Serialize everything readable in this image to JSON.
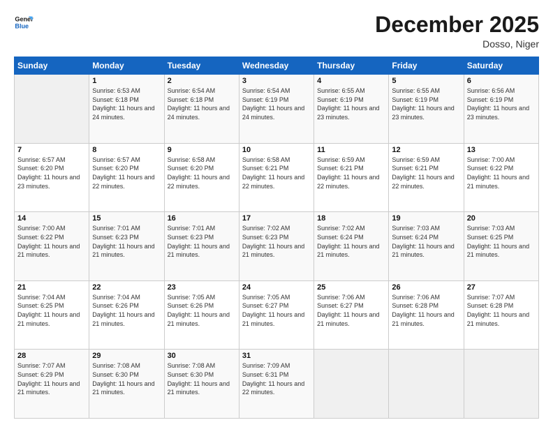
{
  "header": {
    "logo_line1": "General",
    "logo_line2": "Blue",
    "month": "December 2025",
    "location": "Dosso, Niger"
  },
  "weekdays": [
    "Sunday",
    "Monday",
    "Tuesday",
    "Wednesday",
    "Thursday",
    "Friday",
    "Saturday"
  ],
  "weeks": [
    [
      {
        "day": "",
        "sunrise": "",
        "sunset": "",
        "daylight": ""
      },
      {
        "day": "1",
        "sunrise": "6:53 AM",
        "sunset": "6:18 PM",
        "daylight": "11 hours and 24 minutes."
      },
      {
        "day": "2",
        "sunrise": "6:54 AM",
        "sunset": "6:18 PM",
        "daylight": "11 hours and 24 minutes."
      },
      {
        "day": "3",
        "sunrise": "6:54 AM",
        "sunset": "6:19 PM",
        "daylight": "11 hours and 24 minutes."
      },
      {
        "day": "4",
        "sunrise": "6:55 AM",
        "sunset": "6:19 PM",
        "daylight": "11 hours and 23 minutes."
      },
      {
        "day": "5",
        "sunrise": "6:55 AM",
        "sunset": "6:19 PM",
        "daylight": "11 hours and 23 minutes."
      },
      {
        "day": "6",
        "sunrise": "6:56 AM",
        "sunset": "6:19 PM",
        "daylight": "11 hours and 23 minutes."
      }
    ],
    [
      {
        "day": "7",
        "sunrise": "6:57 AM",
        "sunset": "6:20 PM",
        "daylight": "11 hours and 23 minutes."
      },
      {
        "day": "8",
        "sunrise": "6:57 AM",
        "sunset": "6:20 PM",
        "daylight": "11 hours and 22 minutes."
      },
      {
        "day": "9",
        "sunrise": "6:58 AM",
        "sunset": "6:20 PM",
        "daylight": "11 hours and 22 minutes."
      },
      {
        "day": "10",
        "sunrise": "6:58 AM",
        "sunset": "6:21 PM",
        "daylight": "11 hours and 22 minutes."
      },
      {
        "day": "11",
        "sunrise": "6:59 AM",
        "sunset": "6:21 PM",
        "daylight": "11 hours and 22 minutes."
      },
      {
        "day": "12",
        "sunrise": "6:59 AM",
        "sunset": "6:21 PM",
        "daylight": "11 hours and 22 minutes."
      },
      {
        "day": "13",
        "sunrise": "7:00 AM",
        "sunset": "6:22 PM",
        "daylight": "11 hours and 21 minutes."
      }
    ],
    [
      {
        "day": "14",
        "sunrise": "7:00 AM",
        "sunset": "6:22 PM",
        "daylight": "11 hours and 21 minutes."
      },
      {
        "day": "15",
        "sunrise": "7:01 AM",
        "sunset": "6:23 PM",
        "daylight": "11 hours and 21 minutes."
      },
      {
        "day": "16",
        "sunrise": "7:01 AM",
        "sunset": "6:23 PM",
        "daylight": "11 hours and 21 minutes."
      },
      {
        "day": "17",
        "sunrise": "7:02 AM",
        "sunset": "6:23 PM",
        "daylight": "11 hours and 21 minutes."
      },
      {
        "day": "18",
        "sunrise": "7:02 AM",
        "sunset": "6:24 PM",
        "daylight": "11 hours and 21 minutes."
      },
      {
        "day": "19",
        "sunrise": "7:03 AM",
        "sunset": "6:24 PM",
        "daylight": "11 hours and 21 minutes."
      },
      {
        "day": "20",
        "sunrise": "7:03 AM",
        "sunset": "6:25 PM",
        "daylight": "11 hours and 21 minutes."
      }
    ],
    [
      {
        "day": "21",
        "sunrise": "7:04 AM",
        "sunset": "6:25 PM",
        "daylight": "11 hours and 21 minutes."
      },
      {
        "day": "22",
        "sunrise": "7:04 AM",
        "sunset": "6:26 PM",
        "daylight": "11 hours and 21 minutes."
      },
      {
        "day": "23",
        "sunrise": "7:05 AM",
        "sunset": "6:26 PM",
        "daylight": "11 hours and 21 minutes."
      },
      {
        "day": "24",
        "sunrise": "7:05 AM",
        "sunset": "6:27 PM",
        "daylight": "11 hours and 21 minutes."
      },
      {
        "day": "25",
        "sunrise": "7:06 AM",
        "sunset": "6:27 PM",
        "daylight": "11 hours and 21 minutes."
      },
      {
        "day": "26",
        "sunrise": "7:06 AM",
        "sunset": "6:28 PM",
        "daylight": "11 hours and 21 minutes."
      },
      {
        "day": "27",
        "sunrise": "7:07 AM",
        "sunset": "6:28 PM",
        "daylight": "11 hours and 21 minutes."
      }
    ],
    [
      {
        "day": "28",
        "sunrise": "7:07 AM",
        "sunset": "6:29 PM",
        "daylight": "11 hours and 21 minutes."
      },
      {
        "day": "29",
        "sunrise": "7:08 AM",
        "sunset": "6:30 PM",
        "daylight": "11 hours and 21 minutes."
      },
      {
        "day": "30",
        "sunrise": "7:08 AM",
        "sunset": "6:30 PM",
        "daylight": "11 hours and 21 minutes."
      },
      {
        "day": "31",
        "sunrise": "7:09 AM",
        "sunset": "6:31 PM",
        "daylight": "11 hours and 22 minutes."
      },
      {
        "day": "",
        "sunrise": "",
        "sunset": "",
        "daylight": ""
      },
      {
        "day": "",
        "sunrise": "",
        "sunset": "",
        "daylight": ""
      },
      {
        "day": "",
        "sunrise": "",
        "sunset": "",
        "daylight": ""
      }
    ]
  ]
}
